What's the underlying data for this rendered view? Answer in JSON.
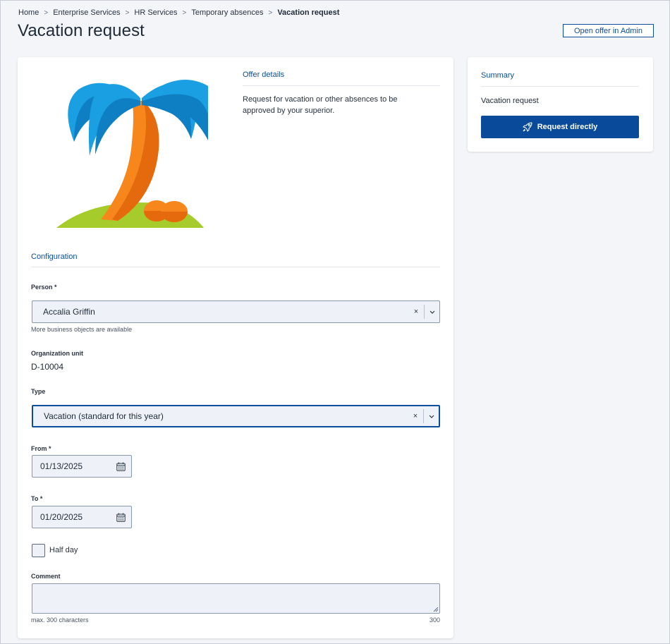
{
  "breadcrumb": [
    "Home",
    "Enterprise Services",
    "HR Services",
    "Temporary absences"
  ],
  "breadcrumb_current": "Vacation request",
  "page_title": "Vacation request",
  "header": {
    "admin_button": "Open offer in Admin"
  },
  "offer": {
    "title": "Offer details",
    "description": "Request for vacation or other absences to be approved by your superior."
  },
  "config": {
    "title": "Configuration",
    "person": {
      "label": "Person *",
      "value": "Accalia Griffin",
      "hint": "More business objects are available"
    },
    "org_unit": {
      "label": "Organization unit",
      "value": "D-10004"
    },
    "type": {
      "label": "Type",
      "value": "Vacation (standard for this year)"
    },
    "from": {
      "label": "From *",
      "value": "01/13/2025"
    },
    "to": {
      "label": "To *",
      "value": "01/20/2025"
    },
    "half_day": {
      "label": "Half day",
      "checked": false
    },
    "comment": {
      "label": "Comment",
      "hint": "max. 300 characters",
      "remaining": "300"
    },
    "clear_symbol": "×"
  },
  "summary": {
    "title": "Summary",
    "item": "Vacation request",
    "button": "Request directly"
  },
  "colors": {
    "accent": "#0b4f9c",
    "button": "#0a4a9a",
    "field_bg": "#eef2f8",
    "page_bg": "#f3f5f9"
  },
  "icons": [
    "chevron-right-icon",
    "clear-icon",
    "chevron-down-icon",
    "calendar-icon",
    "rocket-icon",
    "resize-handle-icon",
    "palm-tree-illustration"
  ]
}
